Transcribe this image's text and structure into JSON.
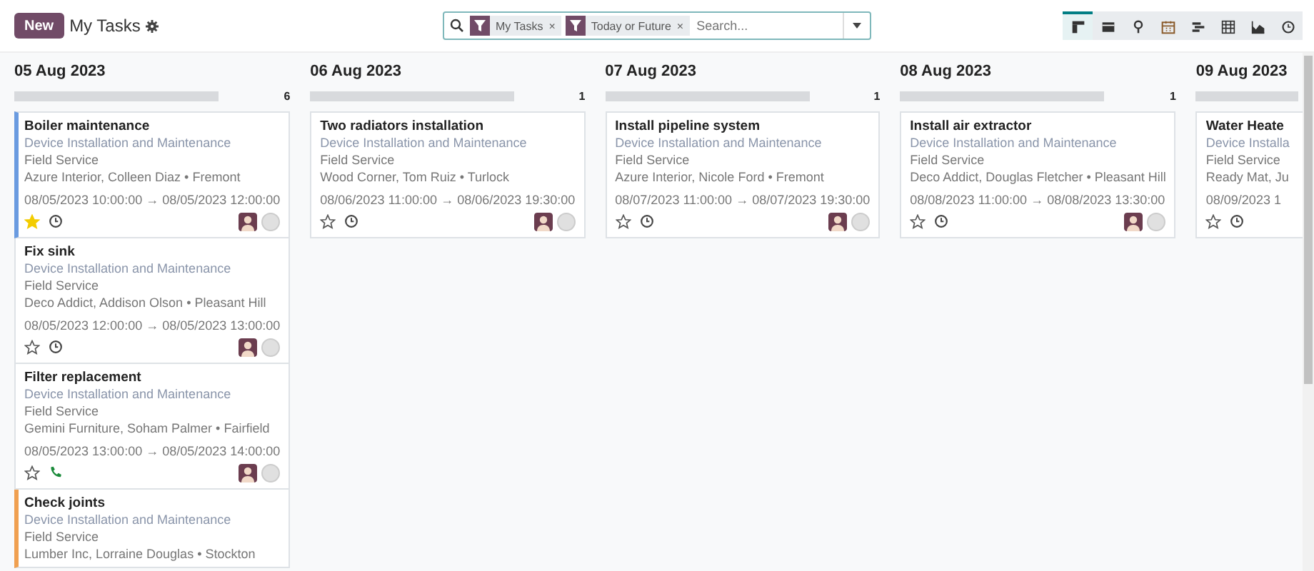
{
  "control_panel": {
    "new_button": "New",
    "title": "My Tasks"
  },
  "search": {
    "facets": [
      {
        "label": "My Tasks",
        "remove": "×"
      },
      {
        "label": "Today or Future",
        "remove": "×"
      }
    ],
    "placeholder": "Search..."
  },
  "views": [
    {
      "kind": "kanban",
      "selected": true
    },
    {
      "kind": "list",
      "selected": false
    },
    {
      "kind": "map",
      "selected": false
    },
    {
      "kind": "calendar",
      "selected": false
    },
    {
      "kind": "gantt",
      "selected": false
    },
    {
      "kind": "pivot",
      "selected": false
    },
    {
      "kind": "graph",
      "selected": false
    },
    {
      "kind": "activity",
      "selected": false
    }
  ],
  "columns": [
    {
      "title": "05 Aug 2023",
      "level": 1,
      "count": "6",
      "cards": [
        {
          "title": "Boiler maintenance",
          "project": "Device Installation and Maintenance",
          "service": "Field Service",
          "customer": "Azure Interior, Colleen Diaz • Fremont",
          "dates": "08/05/2023 10:00:00 → 08/05/2023 12:00:00",
          "starred": true,
          "activity": {
            "kind": "clock"
          },
          "color": "#6a9be0"
        },
        {
          "title": "Fix sink",
          "project": "Device Installation and Maintenance",
          "service": "Field Service",
          "customer": "Deco Addict, Addison Olson • Pleasant Hill",
          "dates": "08/05/2023 12:00:00 → 08/05/2023 13:00:00",
          "starred": false,
          "activity": {
            "kind": "clock"
          }
        },
        {
          "title": "Filter replacement",
          "project": "Device Installation and Maintenance",
          "service": "Field Service",
          "customer": "Gemini Furniture, Soham Palmer • Fairfield",
          "dates": "08/05/2023 13:00:00 → 08/05/2023 14:00:00",
          "starred": false,
          "activity": {
            "kind": "phone"
          }
        },
        {
          "title": "Check joints",
          "project": "Device Installation and Maintenance",
          "service": "Field Service",
          "customer": "Lumber Inc, Lorraine Douglas • Stockton",
          "color": "#f0a050"
        }
      ]
    },
    {
      "title": "06 Aug 2023",
      "level": 1,
      "count": "1",
      "cards": [
        {
          "title": "Two radiators installation",
          "project": "Device Installation and Maintenance",
          "service": "Field Service",
          "customer": "Wood Corner, Tom Ruiz • Turlock",
          "dates": "08/06/2023 11:00:00 → 08/06/2023 19:30:00",
          "starred": false,
          "activity": {
            "kind": "clock"
          }
        }
      ]
    },
    {
      "title": "07 Aug 2023",
      "level": 1,
      "count": "1",
      "cards": [
        {
          "title": "Install pipeline system",
          "project": "Device Installation and Maintenance",
          "service": "Field Service",
          "customer": "Azure Interior, Nicole Ford • Fremont",
          "dates": "08/07/2023 11:00:00 → 08/07/2023 19:30:00",
          "starred": false,
          "activity": {
            "kind": "clock"
          }
        }
      ]
    },
    {
      "title": "08 Aug 2023",
      "level": 1,
      "count": "1",
      "cards": [
        {
          "title": "Install air extractor",
          "project": "Device Installation and Maintenance",
          "service": "Field Service",
          "customer": "Deco Addict, Douglas Fletcher • Pleasant Hill",
          "dates": "08/08/2023 11:00:00 → 08/08/2023 13:30:00",
          "starred": false,
          "activity": {
            "kind": "clock"
          }
        }
      ]
    },
    {
      "title": "09 Aug 2023",
      "level": 1,
      "cards": [
        {
          "title": "Water Heate",
          "project": "Device Installa",
          "service": "Field Service",
          "customer": "Ready Mat, Ju",
          "dates": "08/09/2023 1",
          "starred": false,
          "activity": {
            "kind": "clock"
          }
        }
      ]
    }
  ]
}
